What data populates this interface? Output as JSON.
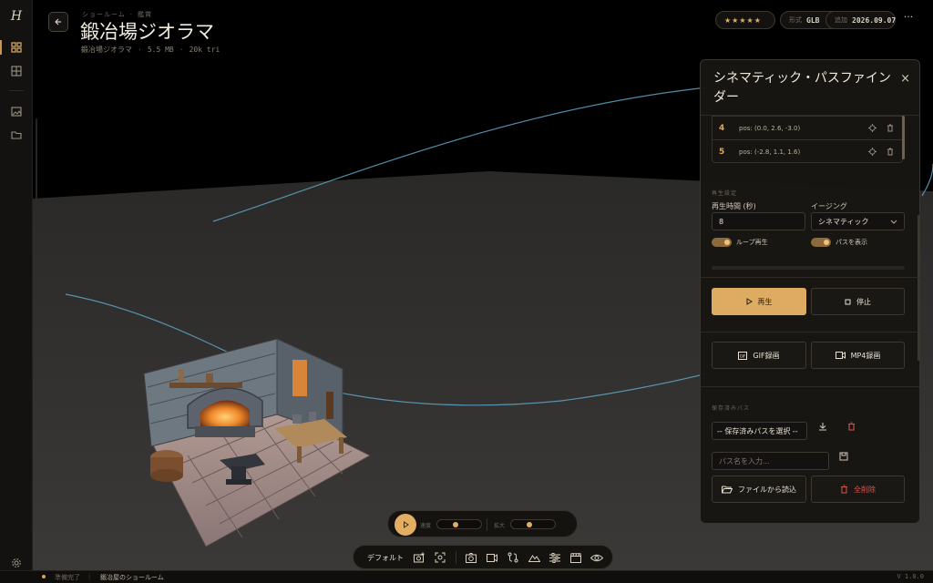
{
  "app": {
    "logo": "H"
  },
  "sidebar": {
    "items": [
      {
        "icon": "grid-icon",
        "active": true
      },
      {
        "icon": "layout-icon",
        "active": false
      },
      {
        "icon": "image-add-icon",
        "active": false
      },
      {
        "icon": "folder-icon",
        "active": false
      },
      {
        "icon": "settings-icon",
        "active": false
      }
    ]
  },
  "header": {
    "breadcrumb": [
      "ショールーム",
      "鑑賞"
    ],
    "title": "鍛冶場ジオラマ",
    "meta": [
      "鍛冶場ジオラマ",
      "5.5 MB",
      "20k tri"
    ],
    "rating": "★★★★★",
    "format_label": "形式",
    "format_value": "GLB",
    "date_label": "追加",
    "date_value": "2026.09.07",
    "more": "···"
  },
  "panel": {
    "title": "シネマティック・パスファインダー",
    "close": "×",
    "waypoints": [
      {
        "num": "4",
        "pos": "pos: (0.0, 2.6, -3.0)"
      },
      {
        "num": "5",
        "pos": "pos: (-2.8, 1.1, 1.6)"
      }
    ],
    "playback_section": "再生設定",
    "duration_label": "再生時間 (秒)",
    "duration_value": "8",
    "easing_label": "イージング",
    "easing_value": "シネマティック",
    "loop_label": "ループ再生",
    "loop_on": true,
    "show_path_label": "パスを表示",
    "show_path_on": true,
    "progress": 0,
    "play_label": "再生",
    "stop_label": "停止",
    "gif_label": "GIF録画",
    "mp4_label": "MP4録画",
    "saved_section": "保存済みパス",
    "saved_select": "-- 保存済みパスを選択 --",
    "name_placeholder": "パス名を入力...",
    "load_label": "ファイルから読込",
    "delete_all_label": "全削除"
  },
  "playbar": {
    "speed_label": "速度",
    "speed_value": 0.35,
    "zoom_label": "拡大",
    "zoom_value": 0.35
  },
  "toolbar": {
    "default_label": "デフォルト",
    "icons": [
      "camera-add-icon",
      "focus-icon",
      "camera-icon",
      "video-icon",
      "path-icon",
      "terrain-icon",
      "sliders-icon",
      "clapper-icon",
      "eye-icon"
    ]
  },
  "status": {
    "state": "準備完了",
    "scene": "鍛冶屋のショールーム",
    "version": "V 1.0.0"
  },
  "colors": {
    "accent": "#deab62",
    "path": "#5fa5c4",
    "danger": "#d7544a"
  }
}
